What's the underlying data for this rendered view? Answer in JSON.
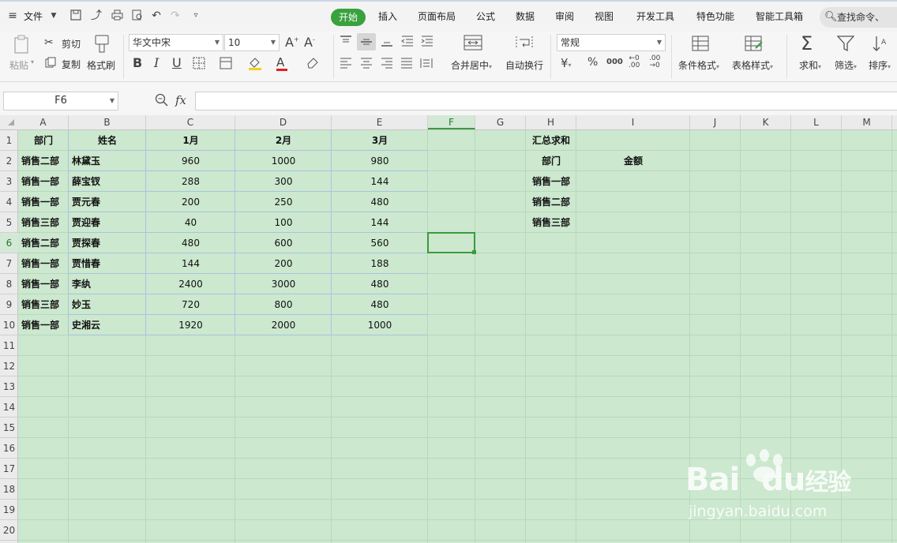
{
  "menubar": {
    "file_label": "文件",
    "tabs": [
      "开始",
      "插入",
      "页面布局",
      "公式",
      "数据",
      "审阅",
      "视图",
      "开发工具",
      "特色功能",
      "智能工具箱"
    ],
    "active_tab": "开始",
    "search_placeholder": "查找命令、"
  },
  "ribbon": {
    "paste": "粘贴",
    "cut": "剪切",
    "copy": "复制",
    "format_painter": "格式刷",
    "font_name": "华文中宋",
    "font_size": "10",
    "grow_font": "A",
    "shrink_font": "A",
    "bold": "B",
    "italic": "I",
    "underline": "U",
    "font_color_glyph": "A",
    "merge_center": "合并居中",
    "wrap_text": "自动换行",
    "number_format": "常规",
    "currency": "¥",
    "percent": "%",
    "thousands": "000",
    "cond_format": "条件格式",
    "table_style": "表格样式",
    "sum": "求和",
    "filter": "筛选",
    "sort": "排序"
  },
  "formula_bar": {
    "name_box": "F6",
    "fx": "fx",
    "value": ""
  },
  "columns": [
    "A",
    "B",
    "C",
    "D",
    "E",
    "F",
    "G",
    "H",
    "I",
    "J",
    "K",
    "L",
    "M"
  ],
  "selected_column": "F",
  "rows": [
    "1",
    "2",
    "3",
    "4",
    "5",
    "6",
    "7",
    "8",
    "9",
    "10",
    "11",
    "12",
    "13",
    "14",
    "15",
    "16",
    "17",
    "18",
    "19",
    "20"
  ],
  "selected_row": "6",
  "table": {
    "headers": [
      "部门",
      "姓名",
      "1月",
      "2月",
      "3月"
    ],
    "rows": [
      [
        "销售二部",
        "林黛玉",
        "960",
        "1000",
        "980"
      ],
      [
        "销售一部",
        "薛宝钗",
        "288",
        "300",
        "144"
      ],
      [
        "销售一部",
        "贾元春",
        "200",
        "250",
        "480"
      ],
      [
        "销售三部",
        "贾迎春",
        "40",
        "100",
        "144"
      ],
      [
        "销售二部",
        "贾探春",
        "480",
        "600",
        "560"
      ],
      [
        "销售一部",
        "贾惜春",
        "144",
        "200",
        "188"
      ],
      [
        "销售一部",
        "李纨",
        "2400",
        "3000",
        "480"
      ],
      [
        "销售三部",
        "妙玉",
        "720",
        "800",
        "480"
      ],
      [
        "销售一部",
        "史湘云",
        "1920",
        "2000",
        "1000"
      ]
    ]
  },
  "summary": {
    "title": "汇总求和",
    "dept_header": "部门",
    "amount_header": "金额",
    "depts": [
      "销售一部",
      "销售二部",
      "销售三部"
    ]
  },
  "watermark": {
    "brand_a": "Bai",
    "brand_b": "du",
    "brand_cn": "经验",
    "url": "jingyan.baidu.com"
  },
  "colors": {
    "accent": "#39a13d",
    "sheet_bg": "#cce8cf",
    "selection": "#3a9b3e"
  }
}
